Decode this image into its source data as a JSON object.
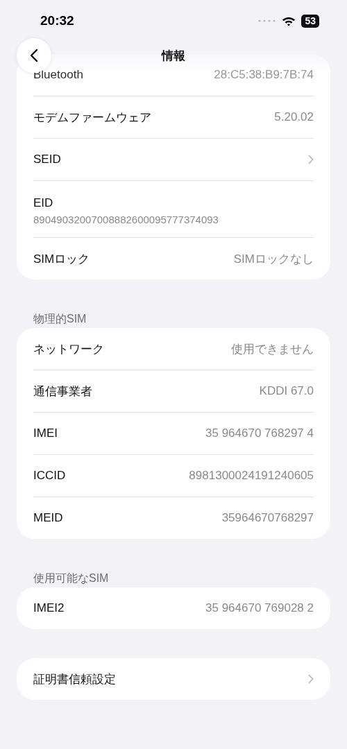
{
  "status_bar": {
    "time": "20:32",
    "battery": "53"
  },
  "header": {
    "title": "情報"
  },
  "sections": [
    {
      "rows": [
        {
          "kind": "value",
          "label": "Bluetooth",
          "value": "28:C5:38:B9:7B:74"
        },
        {
          "kind": "value",
          "label": "モデムファームウェア",
          "value": "5.20.02"
        },
        {
          "kind": "link",
          "label": "SEID"
        },
        {
          "kind": "stacked",
          "label": "EID",
          "value": "89049032007008882600095777374093"
        },
        {
          "kind": "value",
          "label": "SIMロック",
          "value": "SIMロックなし"
        }
      ]
    },
    {
      "title": "物理的SIM",
      "rows": [
        {
          "kind": "value",
          "label": "ネットワーク",
          "value": "使用できません"
        },
        {
          "kind": "value",
          "label": "通信事業者",
          "value": "KDDI 67.0"
        },
        {
          "kind": "value",
          "label": "IMEI",
          "value": "35 964670 768297 4"
        },
        {
          "kind": "value",
          "label": "ICCID",
          "value": "8981300024191240605"
        },
        {
          "kind": "value",
          "label": "MEID",
          "value": "35964670768297"
        }
      ]
    },
    {
      "title": "使用可能なSIM",
      "rows": [
        {
          "kind": "value",
          "label": "IMEI2",
          "value": "35 964670 769028 2"
        }
      ]
    },
    {
      "rows": [
        {
          "kind": "link",
          "label": "証明書信頼設定"
        }
      ]
    }
  ]
}
